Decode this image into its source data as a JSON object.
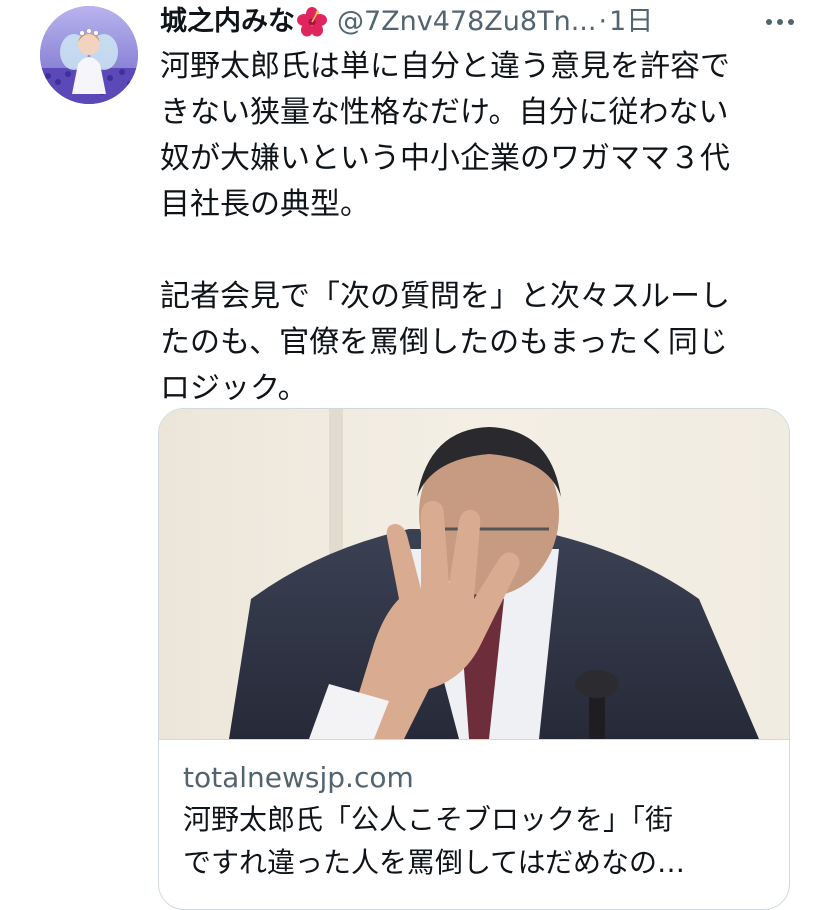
{
  "tweet": {
    "display_name": "城之内みな",
    "name_emoji": "hibiscus-icon",
    "handle": "@7Znv478Zu8Tn...",
    "separator": "·",
    "time": "1日",
    "more_icon": "more-dots-icon",
    "text_lines_1": [
      "河野太郎氏は単に自分と違う意見を許容で",
      "きない狭量な性格なだけ。自分に従わない",
      "奴が大嫌いという中小企業のワガママ３代",
      "目社長の典型。"
    ],
    "text_lines_2": [
      "記者会見で「次の質問を」と次々スルーし",
      "たのも、官僚を罵倒したのもまったく同じ",
      "ロジック。"
    ],
    "card": {
      "image_alt": "man-covering-face-with-hand-photo",
      "domain": "totalnewsjp.com",
      "title_lines": [
        "河野太郎氏「公人こそブロックを」「街",
        "ですれ違った人を罵倒してはだめなの…"
      ]
    }
  },
  "colors": {
    "text": "#0f1419",
    "secondary": "#536471",
    "border": "#cfd9de",
    "hibiscus": "#e0245e"
  }
}
